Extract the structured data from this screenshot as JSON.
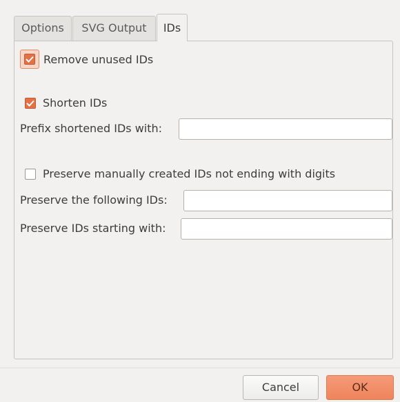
{
  "tabs": [
    {
      "label": "Options",
      "active": false
    },
    {
      "label": "SVG Output",
      "active": false
    },
    {
      "label": "IDs",
      "active": true
    }
  ],
  "ids_tab": {
    "remove_unused": {
      "label": "Remove unused IDs",
      "checked": true,
      "focused": true
    },
    "shorten": {
      "label": "Shorten IDs",
      "checked": true
    },
    "prefix": {
      "label": "Prefix shortened IDs with:",
      "value": ""
    },
    "preserve_manual": {
      "label": "Preserve manually created IDs not ending with digits",
      "checked": false
    },
    "preserve_following": {
      "label": "Preserve the following IDs:",
      "value": ""
    },
    "preserve_starting": {
      "label": "Preserve IDs starting with:",
      "value": ""
    }
  },
  "buttons": {
    "cancel": "Cancel",
    "ok": "OK"
  },
  "colors": {
    "accent": "#e27146",
    "window_bg": "#f2f1f0"
  },
  "icons": {
    "checkmark": "checkmark-icon"
  }
}
